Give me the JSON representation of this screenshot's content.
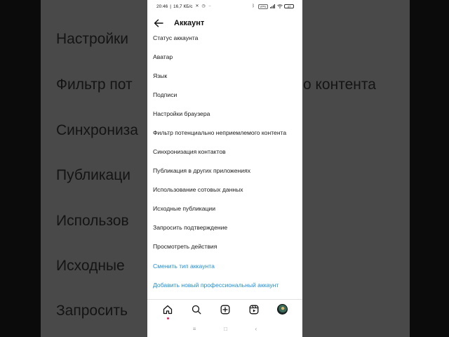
{
  "background": {
    "rows_left": [
      "Настройки",
      "Фильтр пот",
      "Синхрониза",
      "Публикаци",
      "Использов",
      "Исходные",
      "Запросить"
    ],
    "row_right": "о контента"
  },
  "status_bar": {
    "time": "20:46",
    "speed": "16,7 КБ/с",
    "vpn_badge": "VPN",
    "battery": "47"
  },
  "header": {
    "title": "Аккаунт",
    "back_icon": "arrow-left-icon"
  },
  "menu_items": [
    "Статус аккаунта",
    "Аватар",
    "Язык",
    "Подписи",
    "Настройки браузера",
    "Фильтр потенциально неприемлемого контента",
    "Синхронизация контактов",
    "Публикация в других приложениях",
    "Использование сотовых данных",
    "Исходные публикации",
    "Запросить подтверждение",
    "Просмотреть действия"
  ],
  "links": [
    "Сменить тип аккаунта",
    "Добавить новый профессиональный аккаунт"
  ],
  "colors": {
    "link": "#1f8fd6",
    "notification_dot": "#e0245e"
  },
  "bottom_nav": [
    "home-icon",
    "search-icon",
    "create-post-icon",
    "reels-icon",
    "profile-avatar"
  ],
  "system_nav": {
    "menu": "≡",
    "home": "□",
    "back": "‹"
  }
}
